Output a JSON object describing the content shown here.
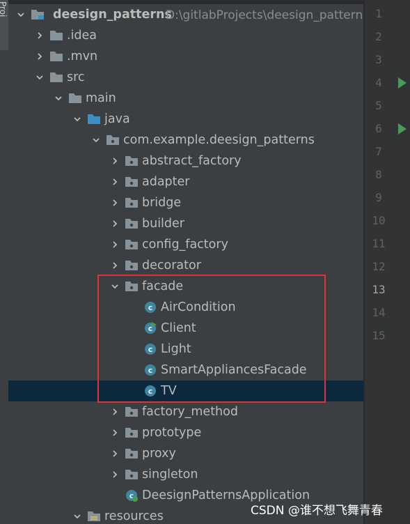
{
  "side_tab": {
    "label": "Proj"
  },
  "project_tree": {
    "root": {
      "name": "deesign_patterns",
      "path": "D:\\gitlabProjects\\deesign_patterns"
    },
    "nodes": [
      {
        "label": ".idea",
        "kind": "folder",
        "icon": "folder-icon",
        "expanded": false
      },
      {
        "label": ".mvn",
        "kind": "folder",
        "icon": "folder-icon",
        "expanded": false
      },
      {
        "label": "src",
        "kind": "folder",
        "icon": "folder-icon",
        "expanded": true
      },
      {
        "label": "main",
        "kind": "folder",
        "icon": "folder-icon",
        "expanded": true
      },
      {
        "label": "java",
        "kind": "source-folder",
        "icon": "source-folder-icon",
        "expanded": true
      },
      {
        "label": "com.example.deesign_patterns",
        "kind": "package",
        "icon": "package-icon",
        "expanded": true
      },
      {
        "label": "abstract_factory",
        "kind": "package",
        "icon": "package-icon",
        "expanded": false
      },
      {
        "label": "adapter",
        "kind": "package",
        "icon": "package-icon",
        "expanded": false
      },
      {
        "label": "bridge",
        "kind": "package",
        "icon": "package-icon",
        "expanded": false
      },
      {
        "label": "builder",
        "kind": "package",
        "icon": "package-icon",
        "expanded": false
      },
      {
        "label": "config_factory",
        "kind": "package",
        "icon": "package-icon",
        "expanded": false
      },
      {
        "label": "decorator",
        "kind": "package",
        "icon": "package-icon",
        "expanded": false
      },
      {
        "label": "facade",
        "kind": "package",
        "icon": "package-icon",
        "expanded": true
      },
      {
        "label": "AirCondition",
        "kind": "class",
        "icon": "class-icon"
      },
      {
        "label": "Client",
        "kind": "runnable-class",
        "icon": "runnable-class-icon"
      },
      {
        "label": "Light",
        "kind": "class",
        "icon": "class-icon"
      },
      {
        "label": "SmartAppliancesFacade",
        "kind": "class",
        "icon": "class-icon"
      },
      {
        "label": "TV",
        "kind": "class",
        "icon": "class-icon",
        "selected": true
      },
      {
        "label": "factory_method",
        "kind": "package",
        "icon": "package-icon",
        "expanded": false
      },
      {
        "label": "prototype",
        "kind": "package",
        "icon": "package-icon",
        "expanded": false
      },
      {
        "label": "proxy",
        "kind": "package",
        "icon": "package-icon",
        "expanded": false
      },
      {
        "label": "singleton",
        "kind": "package",
        "icon": "package-icon",
        "expanded": false
      },
      {
        "label": "DeesignPatternsApplication",
        "kind": "spring-boot-class",
        "icon": "spring-boot-class-icon"
      },
      {
        "label": "resources",
        "kind": "resources-folder",
        "icon": "resources-folder-icon",
        "expanded": true
      }
    ]
  },
  "editor_gutter": {
    "line_numbers": [
      "1",
      "2",
      "3",
      "4",
      "5",
      "6",
      "7",
      "8",
      "9",
      "10",
      "11",
      "12",
      "13",
      "14",
      "15"
    ],
    "current_line": "13",
    "run_markers_on_lines": [
      "4",
      "6"
    ]
  },
  "annotation": {
    "color": "#e0323a",
    "encloses": "facade"
  },
  "watermark": {
    "text": "CSDN @谁不想飞舞青春"
  },
  "colors": {
    "panel_bg": "#3c3f41",
    "selection_bg": "#0d293e",
    "folder": "#87939a",
    "source_folder": "#3d8fc4",
    "class_icon": "#3e86a0",
    "run_green": "#499c54",
    "text": "#bbbbbb",
    "path_text": "#8c8c8c"
  }
}
